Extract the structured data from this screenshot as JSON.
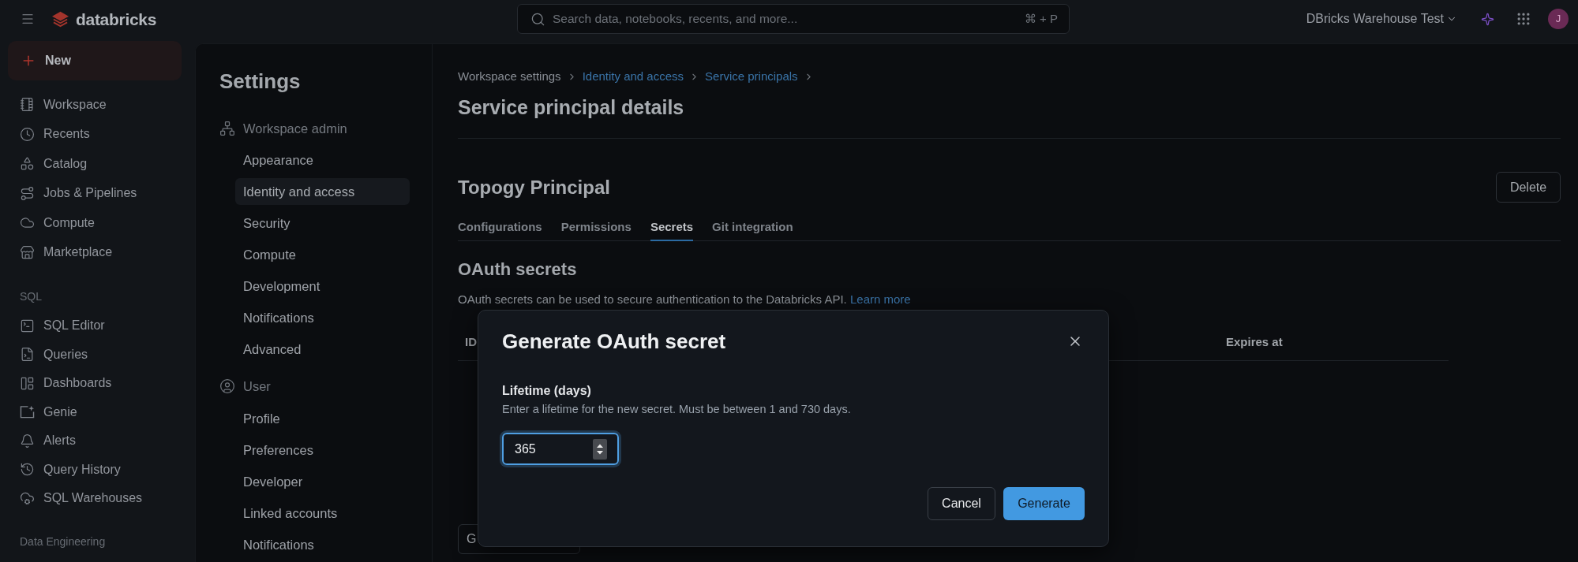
{
  "top_bar": {
    "logo_text": "databricks",
    "search": {
      "placeholder": "Search data, notebooks, recents, and more...",
      "shortcut": "⌘ + P"
    },
    "workspace": "DBricks Warehouse Test",
    "avatar": "J"
  },
  "sidebar": {
    "new_button": "New",
    "groups": [
      {
        "items": [
          "Workspace",
          "Recents",
          "Catalog",
          "Jobs & Pipelines",
          "Compute",
          "Marketplace"
        ]
      },
      {
        "title": "SQL",
        "items": [
          "SQL Editor",
          "Queries",
          "Dashboards",
          "Genie",
          "Alerts",
          "Query History",
          "SQL Warehouses"
        ]
      },
      {
        "title": "Data Engineering"
      }
    ]
  },
  "settings": {
    "title": "Settings",
    "sections": [
      {
        "title": "Workspace admin",
        "items": [
          {
            "label": "Appearance",
            "selected": false
          },
          {
            "label": "Identity and access",
            "selected": true
          },
          {
            "label": "Security",
            "selected": false
          },
          {
            "label": "Compute",
            "selected": false
          },
          {
            "label": "Development",
            "selected": false
          },
          {
            "label": "Notifications",
            "selected": false
          },
          {
            "label": "Advanced",
            "selected": false
          }
        ]
      },
      {
        "title": "User",
        "items": [
          {
            "label": "Profile",
            "selected": false
          },
          {
            "label": "Preferences",
            "selected": false
          },
          {
            "label": "Developer",
            "selected": false
          },
          {
            "label": "Linked accounts",
            "selected": false
          },
          {
            "label": "Notifications",
            "selected": false
          }
        ]
      }
    ]
  },
  "breadcrumb": [
    {
      "label": "Workspace settings",
      "kind": "text"
    },
    {
      "label": "Identity and access",
      "kind": "link"
    },
    {
      "label": "Service principals",
      "kind": "link"
    }
  ],
  "page_title": "Service principal details",
  "principal": {
    "name": "Topogy Principal",
    "delete_button": "Delete"
  },
  "tabs": [
    {
      "label": "Configurations",
      "selected": false
    },
    {
      "label": "Permissions",
      "selected": false
    },
    {
      "label": "Secrets",
      "selected": true
    },
    {
      "label": "Git integration",
      "selected": false
    }
  ],
  "oauth_secrets": {
    "title": "OAuth secrets",
    "description": "OAuth secrets can be used to secure authentication to the Databricks API.",
    "link": "Learn more",
    "table": {
      "columns": [
        "ID",
        "Expires at"
      ]
    },
    "button": "G"
  },
  "dialog": {
    "title": "Generate OAuth secret",
    "field": {
      "label": "Lifetime (days)",
      "help": "Enter a lifetime for the new secret. Must be between 1 and 730 days.",
      "value": "365",
      "focused": true
    },
    "buttons": [
      {
        "label": "Cancel",
        "kind": "secondary"
      },
      {
        "label": "Generate",
        "kind": "primary"
      }
    ]
  }
}
